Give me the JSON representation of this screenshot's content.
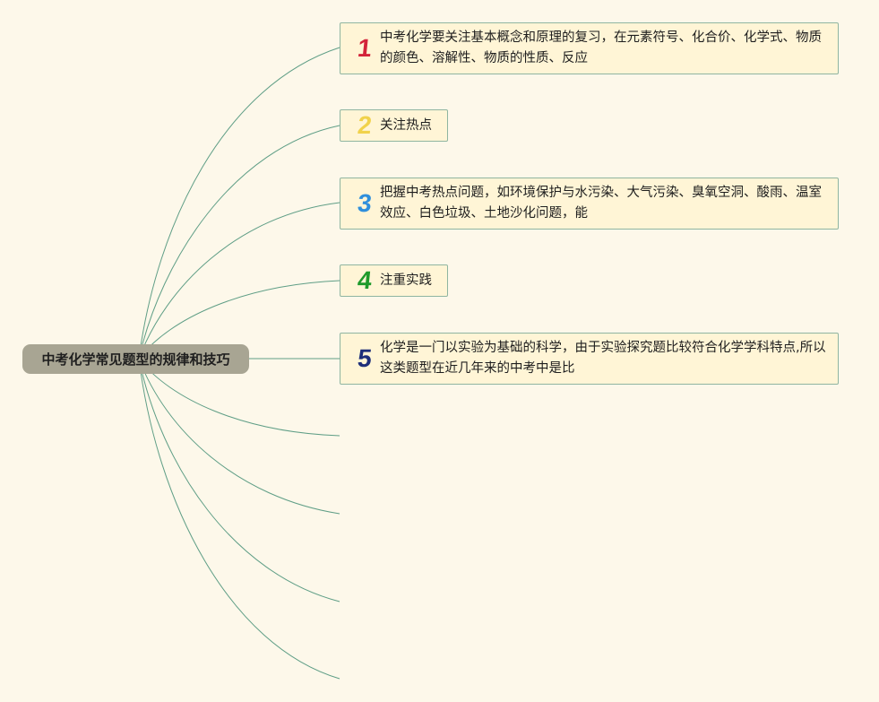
{
  "root": {
    "label": "中考化学常见题型的规律和技巧"
  },
  "topics": [
    {
      "number": "1",
      "color": "#d3243a",
      "text": "中考化学要关注基本概念和原理的复习，在元素符号、化合价、化学式、物质的颜色、溶解性、物质的性质、反应"
    },
    {
      "number": "2",
      "color": "#f1d24b",
      "text": "关注热点"
    },
    {
      "number": "3",
      "color": "#2f8fdc",
      "text": "把握中考热点问题，如环境保护与水污染、大气污染、臭氧空洞、酸雨、温室效应、白色垃圾、土地沙化问题，能"
    },
    {
      "number": "4",
      "color": "#1e9a2b",
      "text": "注重实践"
    },
    {
      "number": "5",
      "color": "#1e2f7a",
      "text": "化学是一门以实验为基础的科学，由于实验探究题比较符合化学学科特点,所以这类题型在近几年来的中考中是比"
    }
  ],
  "connector_color": "#5f9e86",
  "empty_branch_count": 4
}
